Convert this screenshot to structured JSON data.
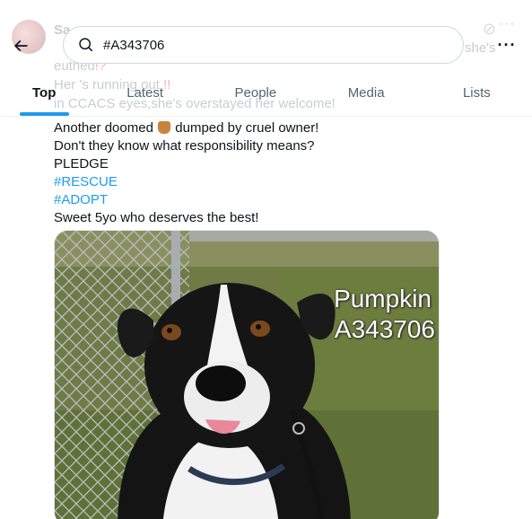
{
  "search": {
    "query": "#A343706"
  },
  "tabs": [
    {
      "label": "Top",
      "active": true
    },
    {
      "label": "Latest",
      "active": false
    },
    {
      "label": "People",
      "active": false
    },
    {
      "label": "Media",
      "active": false
    },
    {
      "label": "Lists",
      "active": false
    }
  ],
  "behind_header": {
    "line2_end": "she's",
    "line3": "euthed",
    "line4": "Her    's running out",
    "line5": "in CCACS eyes,she's overstayed her welcome!"
  },
  "post": {
    "line1_a": "Another doomed",
    "line1_b": "dumped by cruel owner!",
    "line2": "Don't they know what responsibility means?",
    "line3": "PLEDGE",
    "hashtag1": "#RESCUE",
    "hashtag2": "#ADOPT",
    "line6": "Sweet 5yo who deserves the best!"
  },
  "photo": {
    "caption_name": "Pumpkin",
    "caption_id": "A343706"
  },
  "colors": {
    "accent": "#1d9bf0",
    "text": "#0f1419",
    "muted": "#536471"
  }
}
